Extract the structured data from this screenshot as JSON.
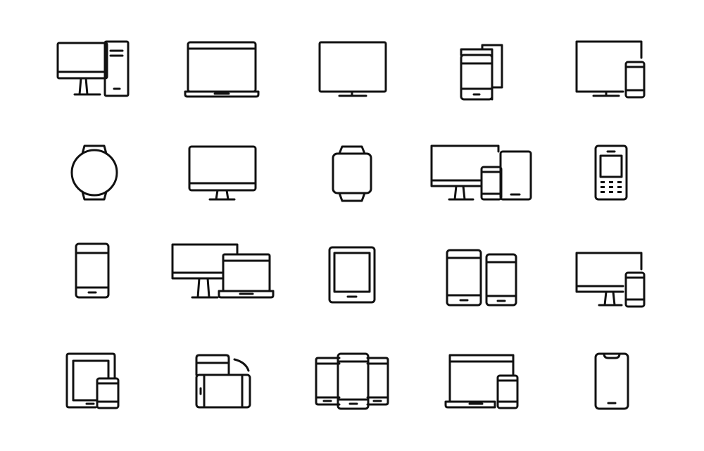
{
  "grid": {
    "line_color": "#111111",
    "background": "#ffffff",
    "icons": [
      {
        "name": "desktop-tower-icon"
      },
      {
        "name": "laptop-icon"
      },
      {
        "name": "monitor-icon"
      },
      {
        "name": "multiple-phones-icon"
      },
      {
        "name": "monitor-phone-icon"
      },
      {
        "name": "smartwatch-round-icon"
      },
      {
        "name": "imac-icon"
      },
      {
        "name": "smartwatch-square-icon"
      },
      {
        "name": "desktop-phone-tablet-icon"
      },
      {
        "name": "keypad-phone-icon"
      },
      {
        "name": "smartphone-icon"
      },
      {
        "name": "desktop-laptop-icon"
      },
      {
        "name": "e-reader-icon"
      },
      {
        "name": "two-phones-icon"
      },
      {
        "name": "imac-phone-icon"
      },
      {
        "name": "tablet-phone-icon"
      },
      {
        "name": "screen-rotation-icon"
      },
      {
        "name": "three-phones-icon"
      },
      {
        "name": "laptop-phone-icon"
      },
      {
        "name": "notch-phone-icon"
      }
    ]
  }
}
